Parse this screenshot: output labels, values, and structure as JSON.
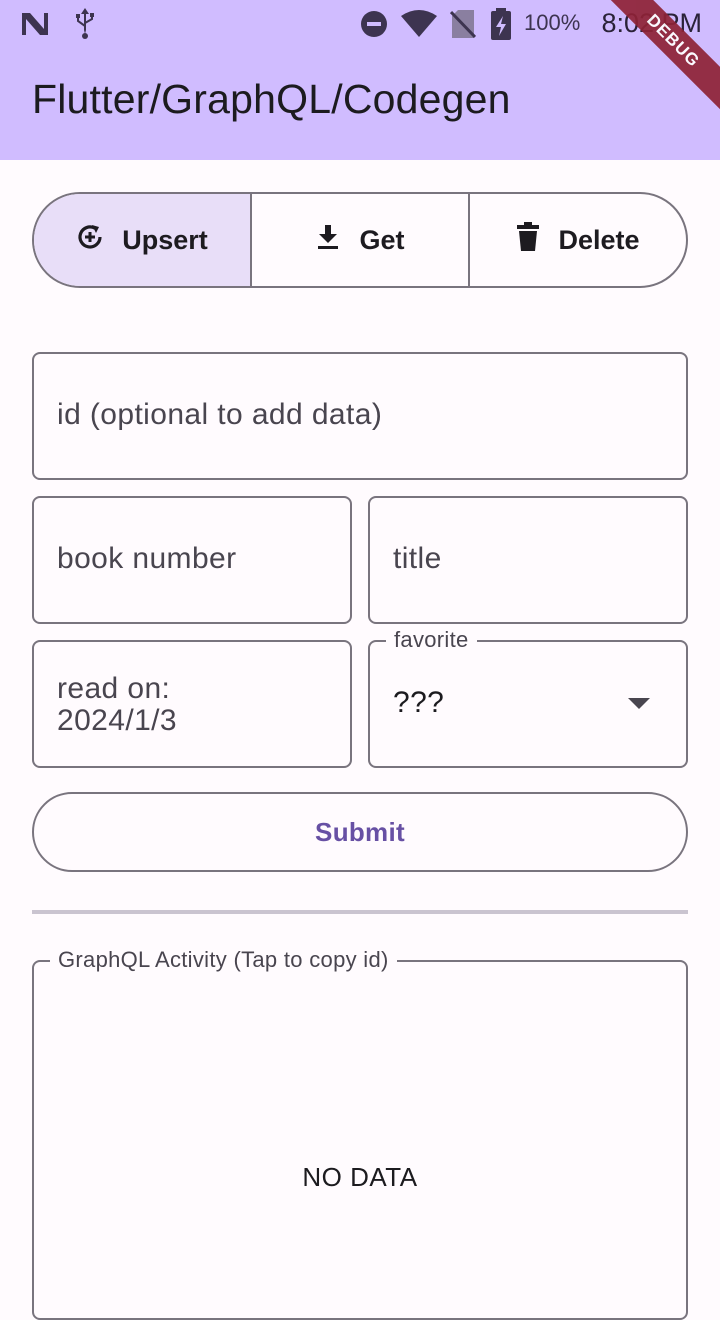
{
  "status_bar": {
    "battery": "100%",
    "time": "8:02 PM",
    "icons": [
      "n-notification-icon",
      "usb-icon",
      "do-not-disturb-icon",
      "wifi-icon",
      "no-sim-icon",
      "battery-charging-icon"
    ]
  },
  "debug_banner": "DEBUG",
  "app_bar": {
    "title": "Flutter/GraphQL/Codegen"
  },
  "segments": [
    {
      "label": "Upsert",
      "icon": "upsert-icon",
      "selected": true
    },
    {
      "label": "Get",
      "icon": "download-icon",
      "selected": false
    },
    {
      "label": "Delete",
      "icon": "trash-icon",
      "selected": false
    }
  ],
  "form": {
    "id_placeholder": "id (optional to add data)",
    "book_number_placeholder": "book number",
    "title_placeholder": "title",
    "read_on_label": "read on:",
    "read_on_value": "2024/1/3",
    "favorite_label": "favorite",
    "favorite_value": "???",
    "submit_label": "Submit"
  },
  "activity": {
    "label": "GraphQL Activity (Tap to copy id)",
    "empty_text": "NO DATA"
  },
  "colors": {
    "app_bar": "#d0bcff",
    "selected_segment": "#e8def8",
    "primary": "#6750a4",
    "outline": "#79747e",
    "debug": "#8e2236"
  }
}
